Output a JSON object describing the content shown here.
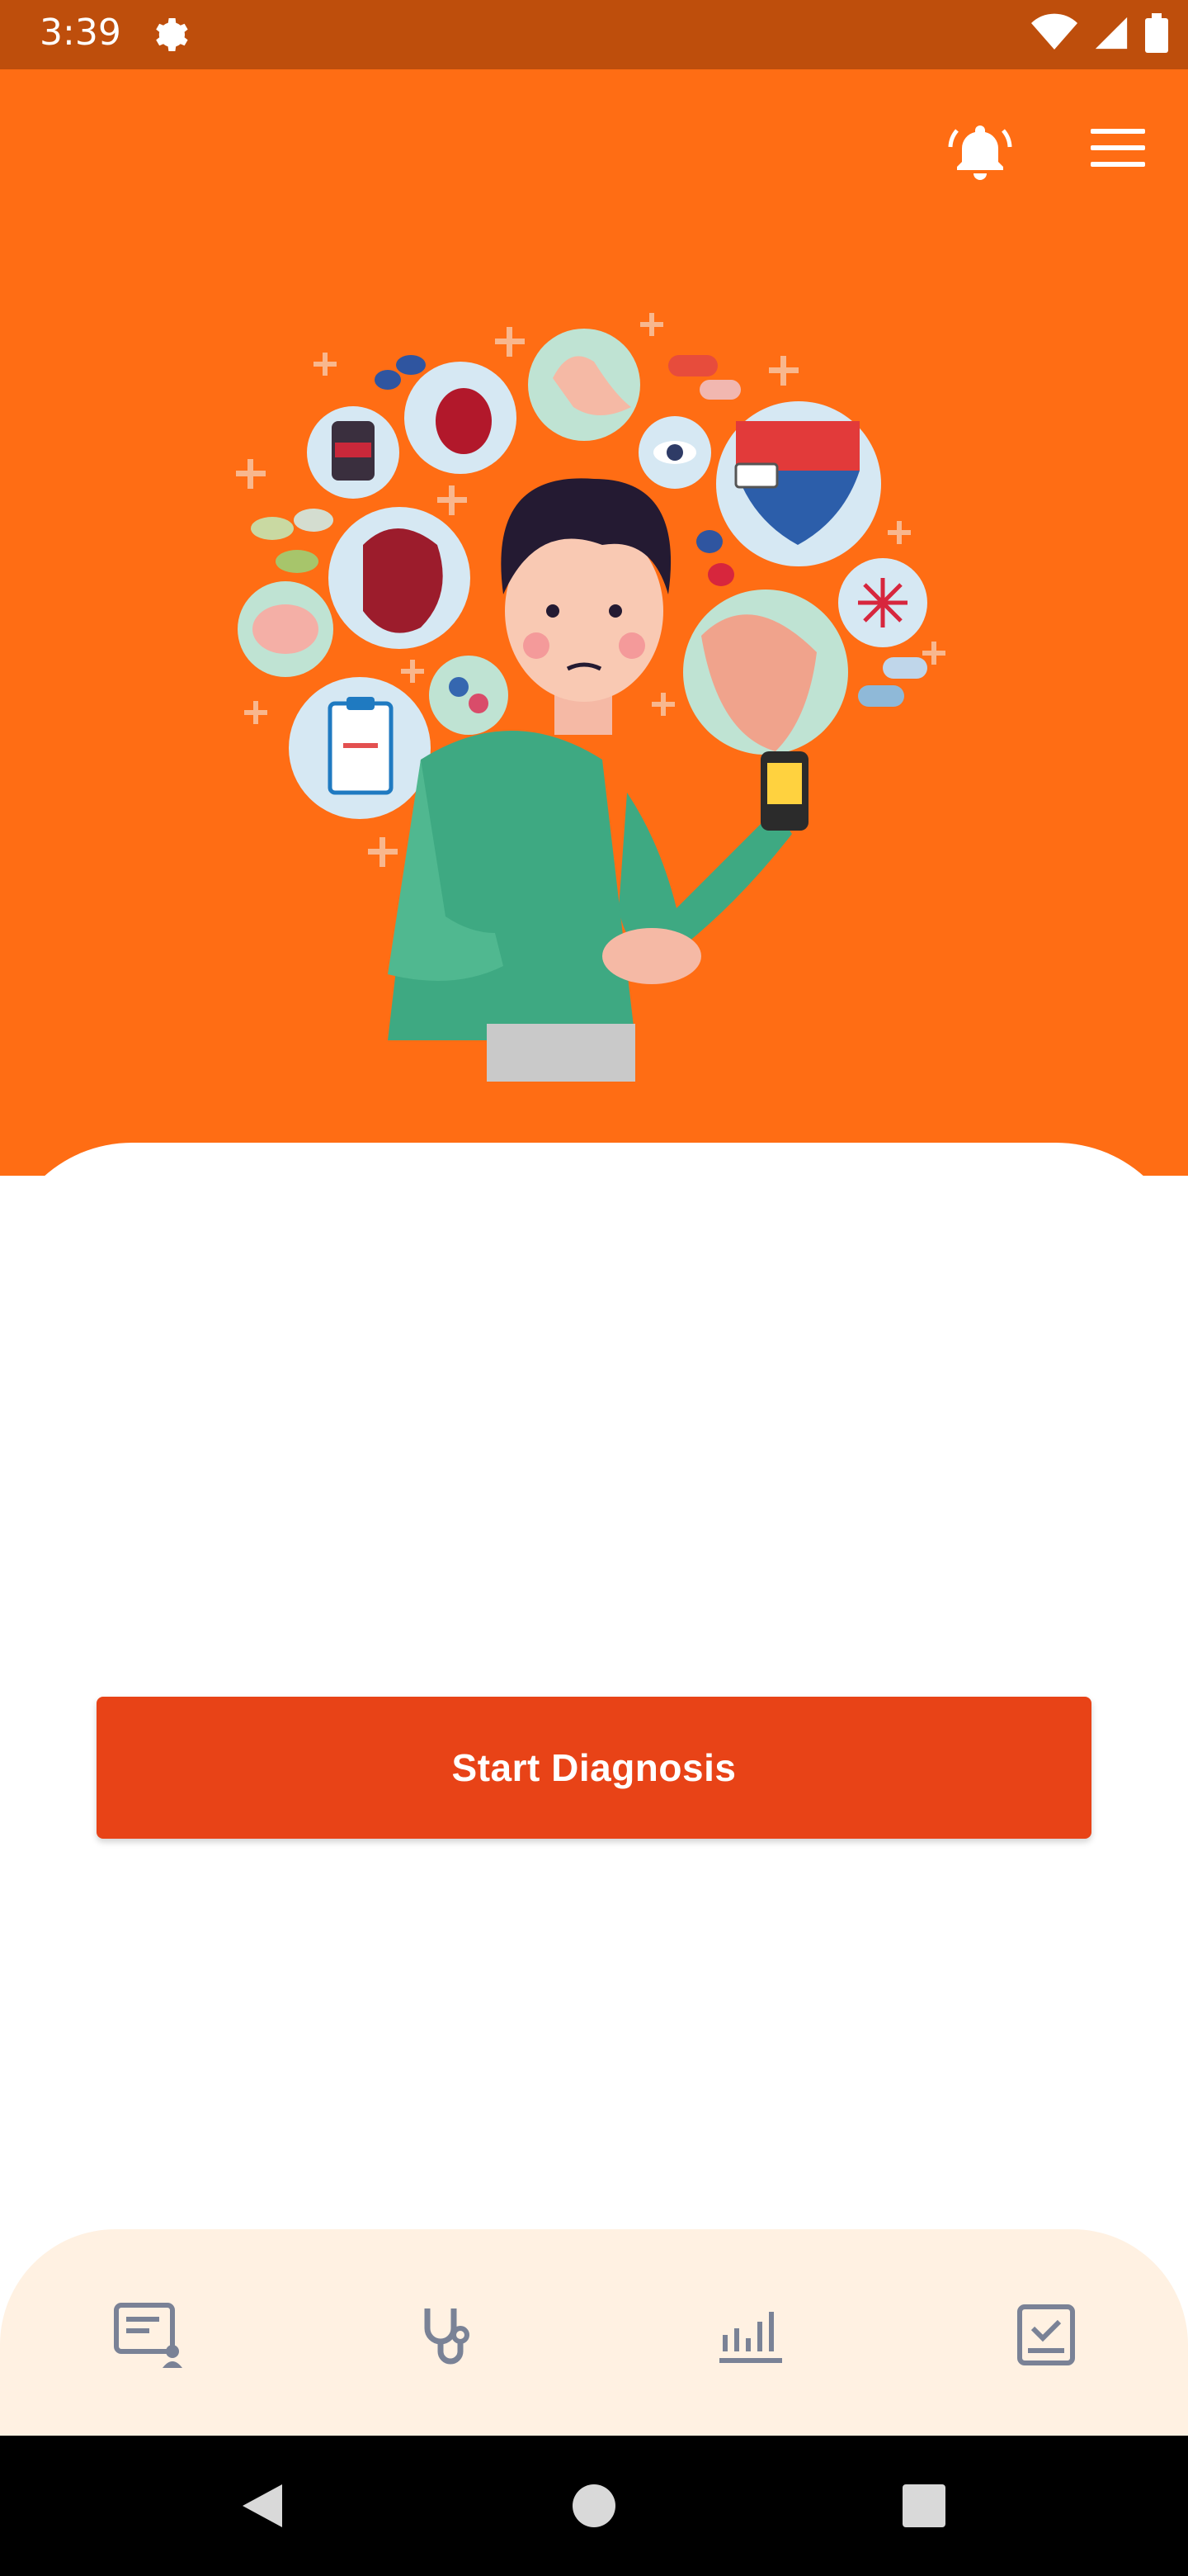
{
  "status_bar": {
    "time": "3:39",
    "icons": [
      "settings-gear-icon",
      "wifi-icon",
      "cell-signal-icon",
      "battery-icon"
    ]
  },
  "header": {
    "background_color": "#FF6D14",
    "icons": [
      "notification-bell-icon",
      "hamburger-menu-icon"
    ]
  },
  "main": {
    "start_button_label": "Start Diagnosis",
    "button_color": "#E84317"
  },
  "bottom_nav": {
    "items": [
      {
        "icon": "patient-record-icon"
      },
      {
        "icon": "stethoscope-icon"
      },
      {
        "icon": "chart-bars-icon"
      },
      {
        "icon": "checklist-icon"
      }
    ],
    "background_color": "#FFF1E2"
  },
  "system_nav": {
    "items": [
      "back-icon",
      "home-icon",
      "recents-icon"
    ]
  }
}
